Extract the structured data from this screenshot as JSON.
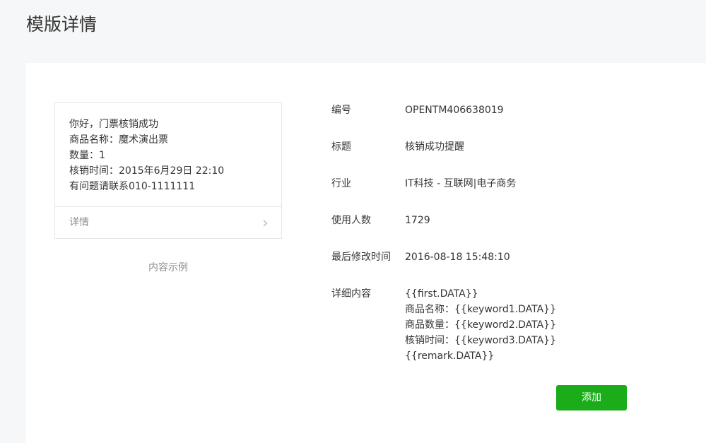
{
  "page_title": "模版详情",
  "preview": {
    "lines": [
      "你好，门票核销成功",
      "商品名称：魔术演出票",
      "数量：1",
      "核销时间：2015年6月29日 22:10",
      "有问题请联系010-1111111"
    ],
    "footer_label": "详情",
    "footer_icon": "chevron-right-icon",
    "caption": "内容示例"
  },
  "details": {
    "id": {
      "label": "编号",
      "value": "OPENTM406638019"
    },
    "title": {
      "label": "标题",
      "value": "核销成功提醒"
    },
    "industry": {
      "label": "行业",
      "value": "IT科技 - 互联网|电子商务"
    },
    "usage_count": {
      "label": "使用人数",
      "value": "1729"
    },
    "modified_time": {
      "label": "最后修改时间",
      "value": "2016-08-18 15:48:10"
    },
    "content": {
      "label": "详细内容",
      "lines": [
        "{{first.DATA}}",
        "商品名称：{{keyword1.DATA}}",
        "商品数量：{{keyword2.DATA}}",
        "核销时间：{{keyword3.DATA}}",
        "{{remark.DATA}}"
      ]
    }
  },
  "add_button_label": "添加",
  "colors": {
    "accent": "#1aad19",
    "background": "#f6f7f8",
    "panel": "#ffffff",
    "text": "#353535",
    "muted_text": "#8d8d8d",
    "border": "#e4e8eb"
  }
}
